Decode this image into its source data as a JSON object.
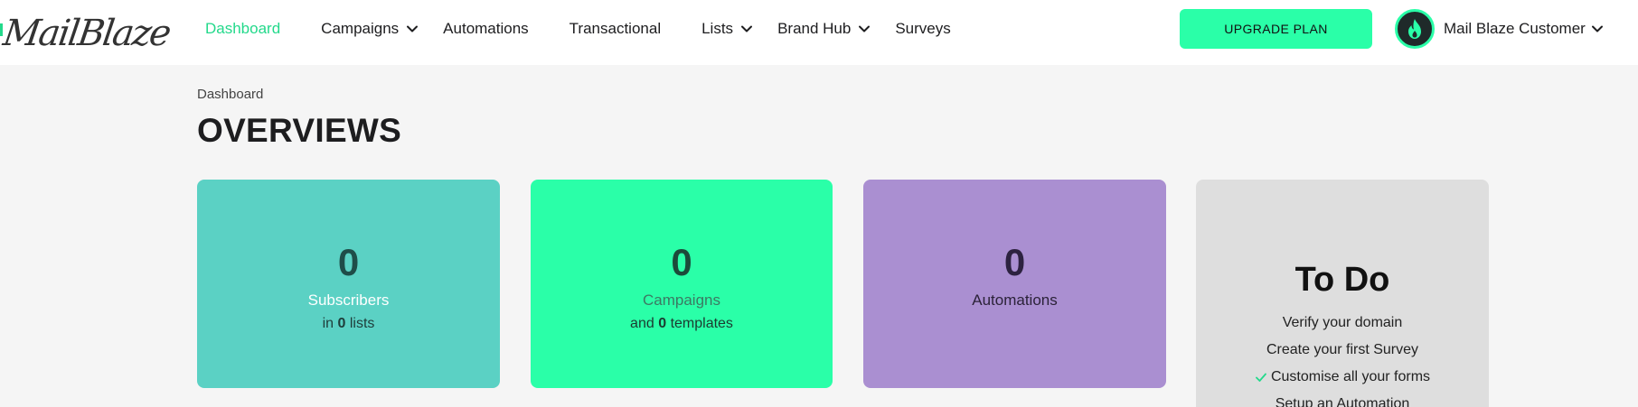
{
  "brand": {
    "logo_text": "MailBlaze",
    "accent": "#23d98b"
  },
  "nav": {
    "items": [
      {
        "label": "Dashboard",
        "active": true,
        "has_dropdown": false
      },
      {
        "label": "Campaigns",
        "active": false,
        "has_dropdown": true
      },
      {
        "label": "Automations",
        "active": false,
        "has_dropdown": false
      },
      {
        "label": "Transactional",
        "active": false,
        "has_dropdown": false
      },
      {
        "label": "Lists",
        "active": false,
        "has_dropdown": true
      },
      {
        "label": "Brand Hub",
        "active": false,
        "has_dropdown": true
      },
      {
        "label": "Surveys",
        "active": false,
        "has_dropdown": false
      }
    ]
  },
  "upgrade_label": "UPGRADE PLAN",
  "user": {
    "name": "Mail Blaze Customer",
    "avatar_icon": "flame-icon"
  },
  "breadcrumb": "Dashboard",
  "page_title": "OVERVIEWS",
  "cards": {
    "subscribers": {
      "count": "0",
      "label": "Subscribers",
      "sub_prefix": "in",
      "sub_count": "0",
      "sub_suffix": "lists",
      "color": "#5bd1c4"
    },
    "campaigns": {
      "count": "0",
      "label": "Campaigns",
      "sub_prefix": "and",
      "sub_count": "0",
      "sub_suffix": "templates",
      "color": "#2affa8"
    },
    "automations": {
      "count": "0",
      "label": "Automations",
      "color": "#aa8fd1"
    }
  },
  "todo": {
    "title": "To Do",
    "items": [
      {
        "label": "Verify your domain",
        "done": false
      },
      {
        "label": "Create your first Survey",
        "done": false
      },
      {
        "label": "Customise all your forms",
        "done": true
      },
      {
        "label": "Setup an Automation",
        "done": false
      }
    ]
  }
}
